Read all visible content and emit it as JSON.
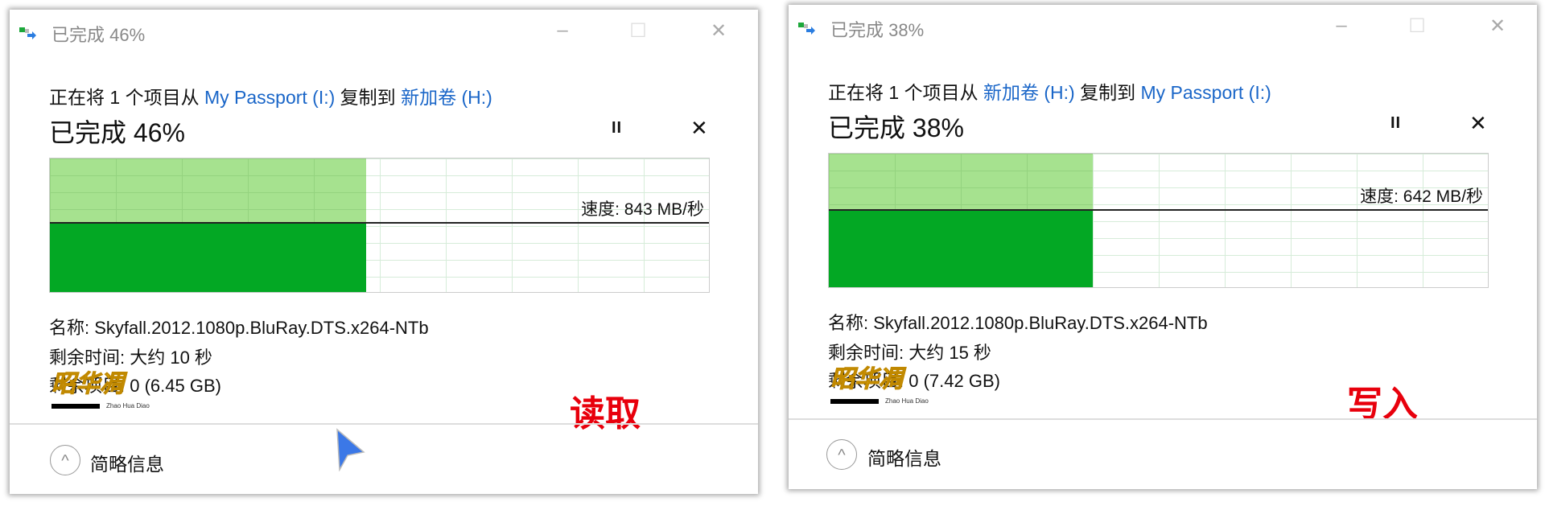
{
  "dialogs": [
    {
      "title": "已完成 46%",
      "prefix": "正在将 1 个项目从",
      "source": "My Passport (I:)",
      "middle": "复制到",
      "dest": "新加卷 (H:)",
      "percent_label": "已完成 46%",
      "progress": 0.46,
      "speed_level": 0.51,
      "speed": "速度: 843 MB/秒",
      "name": "名称: Skyfall.2012.1080p.BluRay.DTS.x264-NTb",
      "time_left": "剩余时间: 大约 10 秒",
      "items_left": "剩余项目: 0 (6.45 GB)",
      "tag": "读取",
      "details_label": "简略信息"
    },
    {
      "title": "已完成 38%",
      "prefix": "正在将 1 个项目从",
      "source": "新加卷 (H:)",
      "middle": "复制到",
      "dest": "My Passport (I:)",
      "percent_label": "已完成 38%",
      "progress": 0.38,
      "speed_level": 0.57,
      "speed": "速度: 642 MB/秒",
      "name": "名称: Skyfall.2012.1080p.BluRay.DTS.x264-NTb",
      "time_left": "剩余时间: 大约 15 秒",
      "items_left": "剩余项目: 0 (7.42 GB)",
      "tag": "写入",
      "details_label": "简略信息"
    }
  ],
  "window_controls": {
    "minimize": "–",
    "maximize": "☐",
    "close": "✕",
    "pause": "II",
    "cancel": "✕",
    "collapse": "^"
  },
  "watermark": {
    "text": "昭华凋",
    "sub": "Zhao Hua Diao"
  },
  "colors": {
    "link": "#1a66c8",
    "fill_light": "#a6e28f",
    "fill_dark": "#03a824",
    "tag": "#e8000c"
  }
}
